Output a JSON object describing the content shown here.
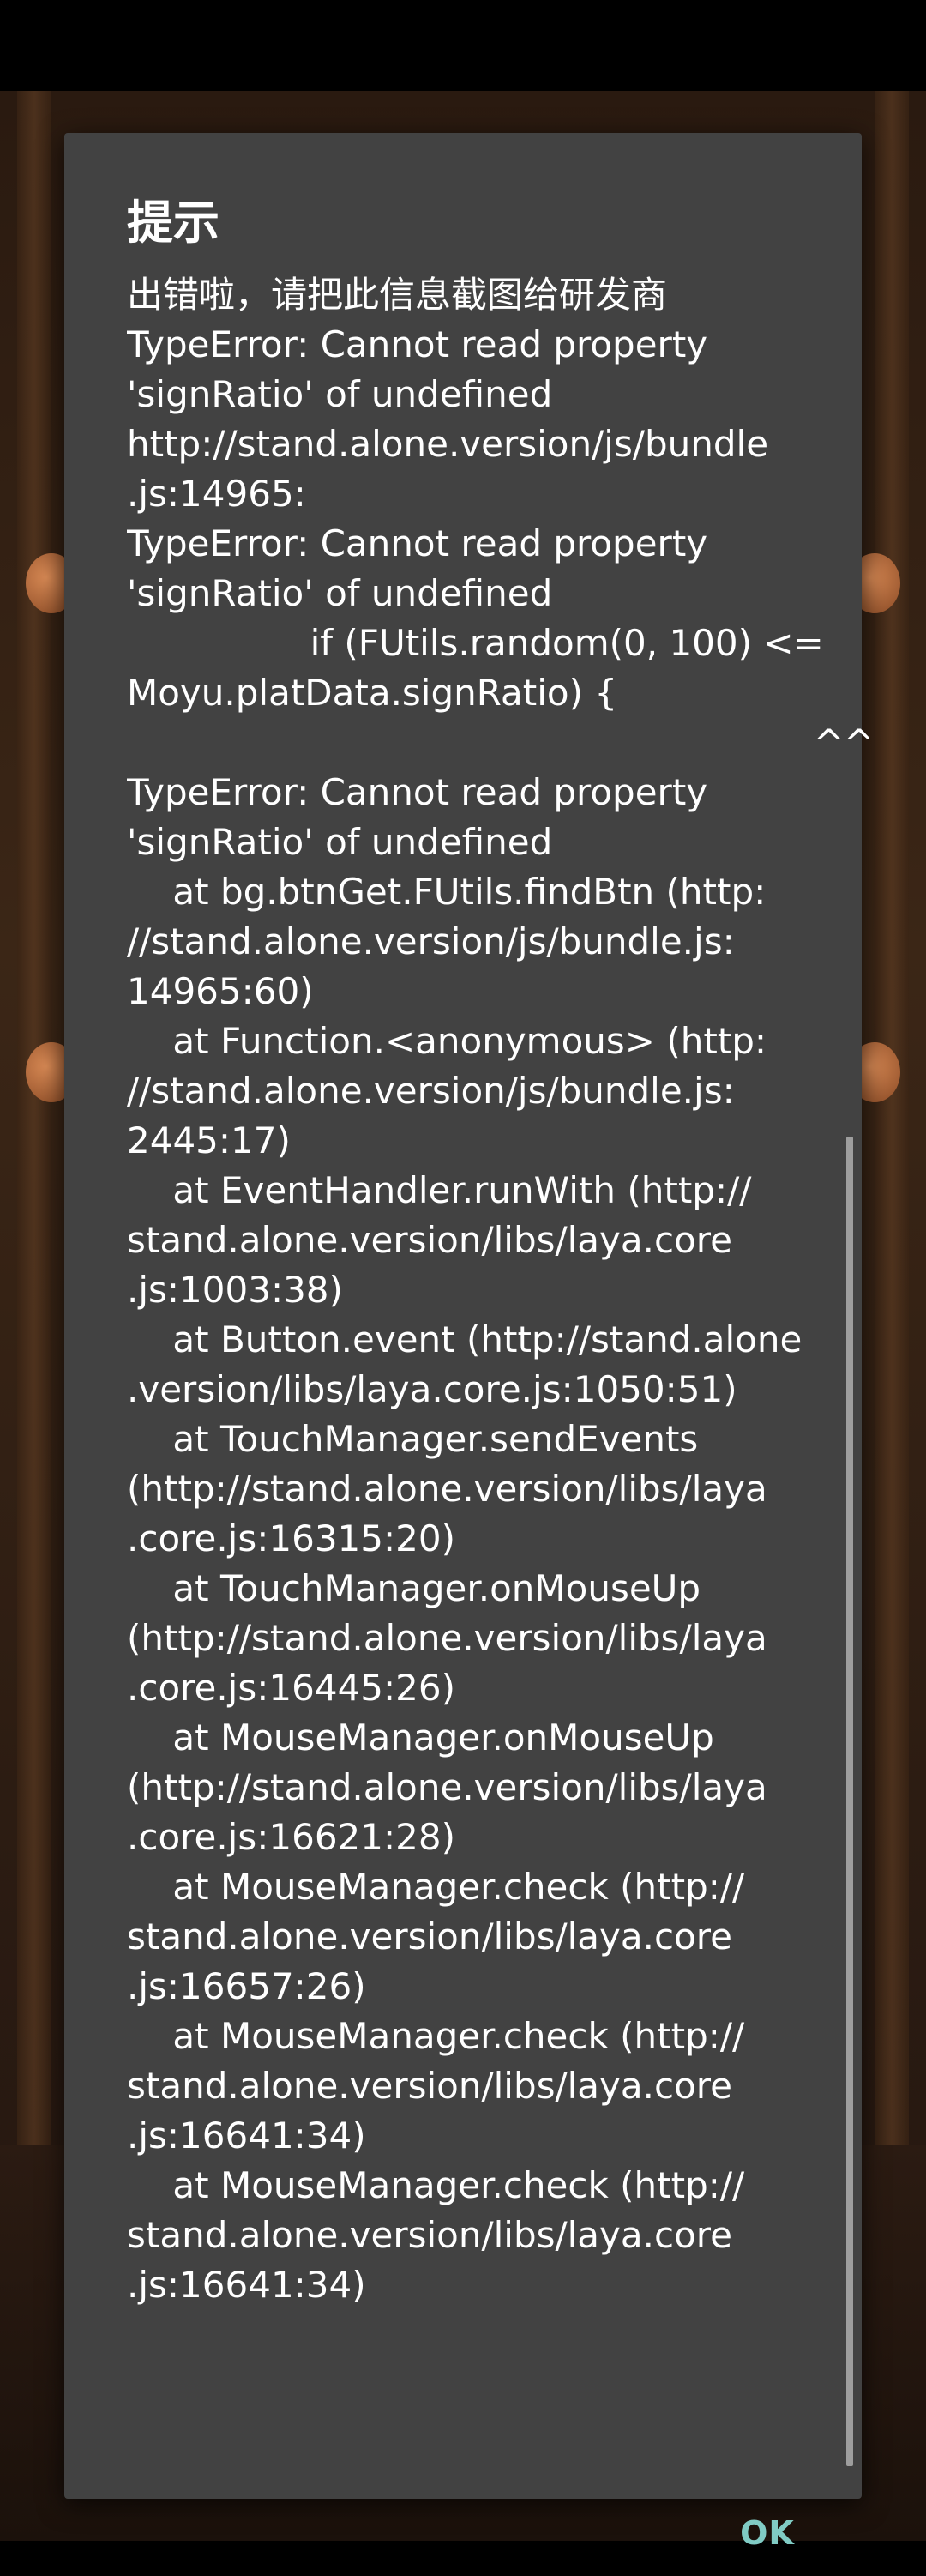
{
  "dialog": {
    "title": "提示",
    "message": "出错啦，请把此信息截图给研发商\nTypeError: Cannot read property\n'signRatio' of undefined\nhttp://stand.alone.version/js/bundle\n.js:14965:\nTypeError: Cannot read property\n'signRatio' of undefined\n                if (FUtils.random(0, 100) <=\nMoyu.platData.signRatio) {\n                                                            ^^\nTypeError: Cannot read property\n'signRatio' of undefined\n    at bg.btnGet.FUtils.findBtn (http:\n//stand.alone.version/js/bundle.js:\n14965:60)\n    at Function.<anonymous> (http:\n//stand.alone.version/js/bundle.js:\n2445:17)\n    at EventHandler.runWith (http://\nstand.alone.version/libs/laya.core\n.js:1003:38)\n    at Button.event (http://stand.alone\n.version/libs/laya.core.js:1050:51)\n    at TouchManager.sendEvents\n(http://stand.alone.version/libs/laya\n.core.js:16315:20)\n    at TouchManager.onMouseUp\n(http://stand.alone.version/libs/laya\n.core.js:16445:26)\n    at MouseManager.onMouseUp\n(http://stand.alone.version/libs/laya\n.core.js:16621:28)\n    at MouseManager.check (http://\nstand.alone.version/libs/laya.core\n.js:16657:26)\n    at MouseManager.check (http://\nstand.alone.version/libs/laya.core\n.js:16641:34)\n    at MouseManager.check (http://\nstand.alone.version/libs/laya.core\n.js:16641:34)",
    "ok_label": "OK"
  },
  "colors": {
    "dialog_background": "#424242",
    "accent": "#80cbc4",
    "text": "#ffffff",
    "status_bar": "#000000"
  }
}
